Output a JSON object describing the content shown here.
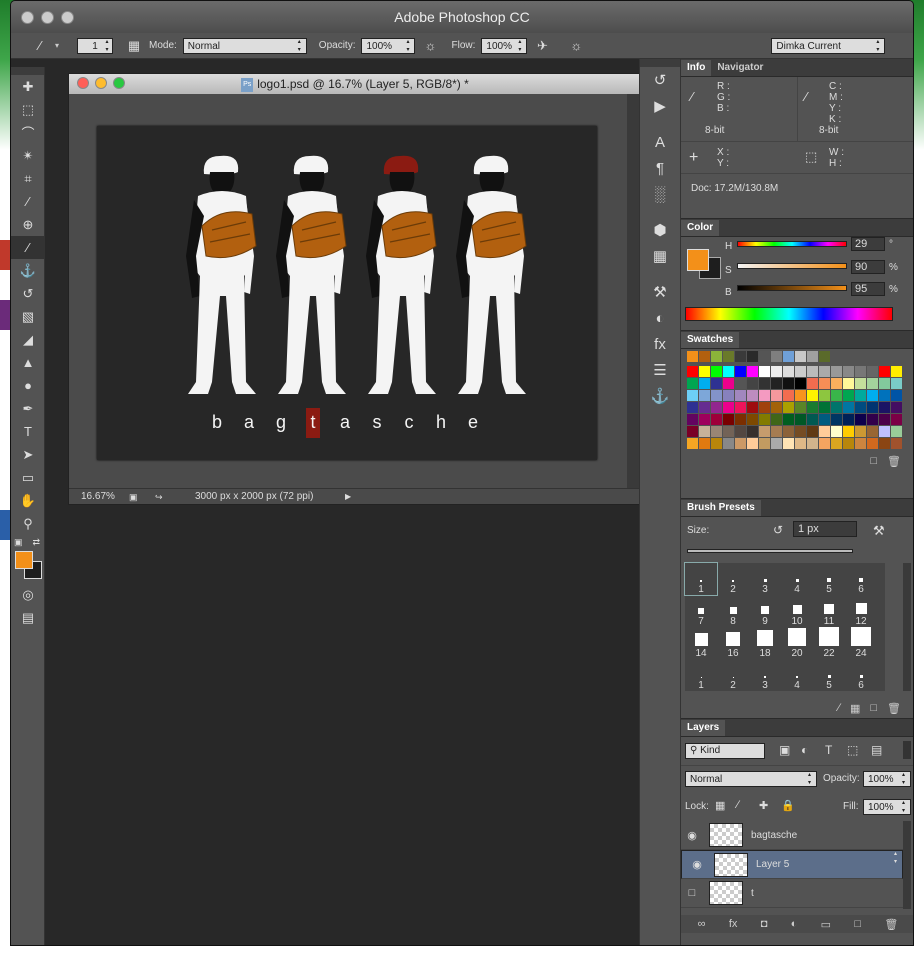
{
  "app": {
    "title": "Adobe Photoshop CC"
  },
  "options": {
    "brush_size": "1",
    "mode_label": "Mode:",
    "mode_value": "Normal",
    "opacity_label": "Opacity:",
    "opacity_value": "100%",
    "flow_label": "Flow:",
    "flow_value": "100%",
    "workspace": "Dimka Current"
  },
  "document": {
    "title": "logo1.psd @ 16.7% (Layer 5, RGB/8*) *",
    "zoom": "16.67%",
    "size_info": "3000 px x 2000 px (72 ppi)",
    "logo_letters": [
      "b",
      "a",
      "g",
      "t",
      "a",
      "s",
      "c",
      "h",
      "e"
    ],
    "highlight_letter_index": 3,
    "colors": {
      "figure": "#f4f4f4",
      "bag": "#b2600f",
      "accent_red": "#8b1b12",
      "canvas_bg": "#272727"
    }
  },
  "info": {
    "tab_info": "Info",
    "tab_navigator": "Navigator",
    "rgb_labels": [
      "R :",
      "G :",
      "B :"
    ],
    "cmyk_labels": [
      "C :",
      "M :",
      "Y :",
      "K :"
    ],
    "bit_left": "8-bit",
    "bit_right": "8-bit",
    "xy_labels": [
      "X :",
      "Y :"
    ],
    "wh_labels": [
      "W :",
      "H :"
    ],
    "doc_size": "Doc: 17.2M/130.8M"
  },
  "color": {
    "tab": "Color",
    "h_label": "H",
    "s_label": "S",
    "b_label": "B",
    "h_value": "29",
    "s_value": "90",
    "b_value": "95",
    "h_unit": "°",
    "s_unit": "%",
    "b_unit": "%",
    "foreground": "#f39019",
    "background": "#1e1e1e"
  },
  "swatches": {
    "tab": "Swatches",
    "recent": [
      "#f39019",
      "#b2600f",
      "#8bb33a",
      "#6a7a2a",
      "#3a3a3a",
      "#2a2a2a",
      "#555555",
      "#7f7f7f",
      "#6fa0d8",
      "#c8c8c8",
      "#a0a0a0",
      "#5a6a2a"
    ],
    "grid": [
      [
        "#ff0000",
        "#ffff00",
        "#00ff00",
        "#00ffff",
        "#0000ff",
        "#ff00ff",
        "#ffffff",
        "#eeeeee",
        "#dddddd",
        "#cccccc",
        "#bbbbbb",
        "#aaaaaa",
        "#999999",
        "#888888",
        "#777777",
        "#666666",
        "#ff0000",
        "#ffee00"
      ],
      [
        "#00a651",
        "#00aeef",
        "#2e3192",
        "#ec008c",
        "#555555",
        "#444444",
        "#333333",
        "#222222",
        "#111111",
        "#000000",
        "#f26c4f",
        "#f68e56",
        "#fbaf5d",
        "#fff799",
        "#c4df9b",
        "#a3d39c",
        "#82ca9c",
        "#7accc8"
      ],
      [
        "#6dcff6",
        "#7da7d9",
        "#8393ca",
        "#8781bd",
        "#a187be",
        "#bd8cbf",
        "#f49ac1",
        "#f5989d",
        "#f26c4f",
        "#f7941d",
        "#fff200",
        "#8dc63f",
        "#39b54a",
        "#00a651",
        "#00a99d",
        "#00aeef",
        "#0072bc",
        "#0054a6"
      ],
      [
        "#2e3192",
        "#662d91",
        "#92278f",
        "#ec008c",
        "#ed145b",
        "#9e0b0f",
        "#a0410d",
        "#a36209",
        "#aba000",
        "#598527",
        "#197b30",
        "#007236",
        "#00746b",
        "#0076a3",
        "#004b80",
        "#003471",
        "#1b1464",
        "#440e62"
      ],
      [
        "#630460",
        "#9e005d",
        "#9e0039",
        "#790000",
        "#7b2e00",
        "#7d4900",
        "#827b00",
        "#406618",
        "#005e20",
        "#005826",
        "#005952",
        "#005b7f",
        "#003663",
        "#002157",
        "#0d004c",
        "#32004b",
        "#4b0049",
        "#7b0046"
      ],
      [
        "#7a0026",
        "#c7b299",
        "#998675",
        "#736357",
        "#534741",
        "#37302d",
        "#c69c6d",
        "#a67c52",
        "#8c6239",
        "#754c24",
        "#603913",
        "#ffcc99",
        "#ffffcc",
        "#ffcc00",
        "#cc9933",
        "#996633",
        "#c0c0ff",
        "#99cc99"
      ],
      [
        "#f5a623",
        "#e07a10",
        "#b8860b",
        "#888888",
        "#cc9966",
        "#ffcc99",
        "#c29b61",
        "#aaaaaa",
        "#ffe4b5",
        "#deb887",
        "#d2b48c",
        "#f4a460",
        "#daa520",
        "#b8860b",
        "#cd853f",
        "#d2691e",
        "#8b4513",
        "#a0522d"
      ]
    ]
  },
  "brushes": {
    "tab": "Brush Presets",
    "size_label": "Size:",
    "size_value": "1 px",
    "rows": [
      [
        "1",
        "2",
        "3",
        "4",
        "5",
        "6"
      ],
      [
        "7",
        "8",
        "9",
        "10",
        "11",
        "12"
      ],
      [
        "14",
        "16",
        "18",
        "20",
        "22",
        "24"
      ],
      [
        "1",
        "2",
        "3",
        "4",
        "5",
        "6"
      ]
    ]
  },
  "layers": {
    "tab": "Layers",
    "kind": "Kind",
    "blend": "Normal",
    "opacity_label": "Opacity:",
    "opacity_value": "100%",
    "lock_label": "Lock:",
    "fill_label": "Fill:",
    "fill_value": "100%",
    "items": [
      {
        "name": "bagtasche",
        "visible": true,
        "selected": false
      },
      {
        "name": "Layer 5",
        "visible": true,
        "selected": true
      },
      {
        "name": "t",
        "visible": false,
        "selected": false
      }
    ]
  }
}
